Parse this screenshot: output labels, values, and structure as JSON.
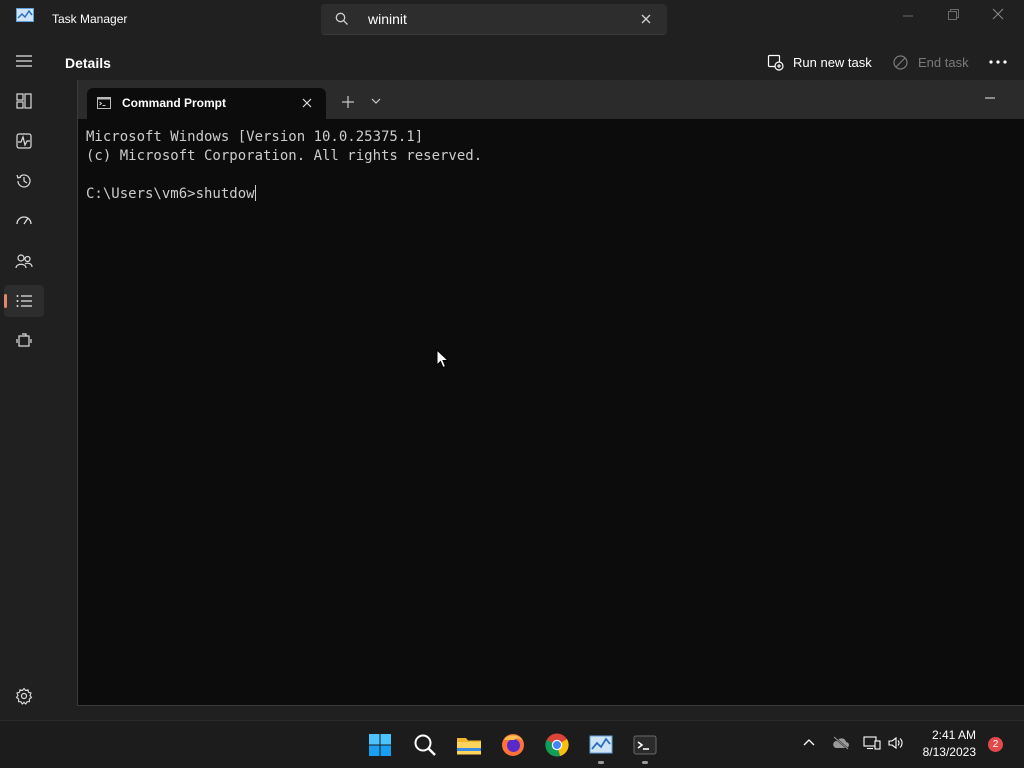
{
  "task_manager": {
    "title": "Task Manager",
    "search": {
      "value": "wininit"
    },
    "page_title": "Details",
    "toolbar": {
      "run_new_task": "Run new task",
      "end_task": "End task"
    },
    "sidebar": {
      "items": [
        {
          "icon": "hamburger-menu-icon"
        },
        {
          "icon": "processes-icon"
        },
        {
          "icon": "performance-icon"
        },
        {
          "icon": "app-history-icon"
        },
        {
          "icon": "startup-apps-icon"
        },
        {
          "icon": "users-icon"
        },
        {
          "icon": "details-icon",
          "active": true
        },
        {
          "icon": "services-icon"
        },
        {
          "icon": "settings-icon"
        }
      ]
    }
  },
  "cmd": {
    "tab_title": "Command Prompt",
    "lines": [
      "Microsoft Windows [Version 10.0.25375.1]",
      "(c) Microsoft Corporation. All rights reserved.",
      "",
      "C:\\Users\\vm6>shutdow"
    ]
  },
  "taskbar": {
    "apps": [
      "start-icon",
      "search-icon",
      "file-explorer-icon",
      "firefox-icon",
      "chrome-icon",
      "task-manager-icon",
      "terminal-icon"
    ],
    "clock": {
      "time": "2:41 AM",
      "date": "8/13/2023"
    },
    "notification_count": "2"
  },
  "colors": {
    "accent": "#e5866b",
    "console_bg": "#0c0c0c",
    "console_text": "#cccccc",
    "taskbar_bg": "#1c1c1c"
  }
}
